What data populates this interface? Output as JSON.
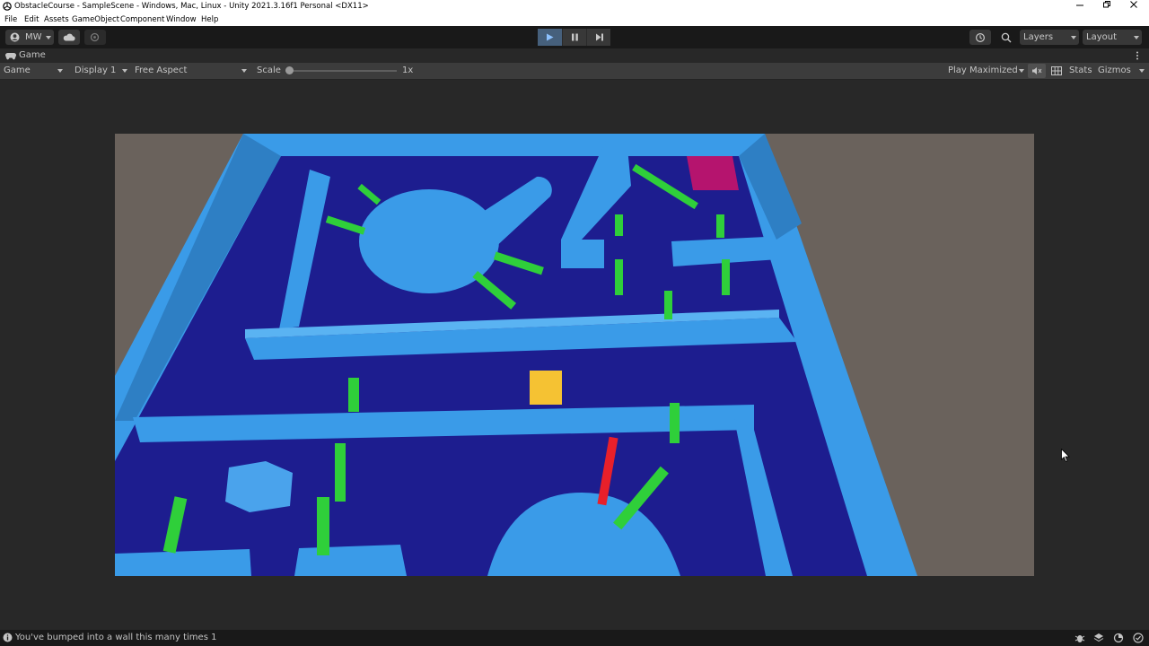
{
  "window": {
    "title": "ObstacleCourse - SampleScene - Windows, Mac, Linux - Unity 2021.3.16f1 Personal <DX11>"
  },
  "menu": [
    "File",
    "Edit",
    "Assets",
    "GameObject",
    "Component",
    "Window",
    "Help"
  ],
  "toolbar": {
    "account_label": "MW",
    "layers_label": "Layers",
    "layout_label": "Layout"
  },
  "tab": {
    "label": "Game"
  },
  "game_toolbar": {
    "mode": "Game",
    "display": "Display 1",
    "aspect": "Free Aspect",
    "scale_label": "Scale",
    "scale_value": "1x",
    "scale_fraction": 0.0,
    "play_mode": "Play Maximized",
    "stats_label": "Stats",
    "gizmos_label": "Gizmos"
  },
  "status": {
    "message": "You've bumped into a wall this many times 1"
  },
  "colors": {
    "floor": "#1d1d8f",
    "wall": "#3a9be8",
    "obstacle_green": "#2fcf3a",
    "player_yellow": "#f5c233",
    "goal_magenta": "#b5146e",
    "obstacle_red": "#e8202a",
    "background_ground": "#6a625c",
    "play_active": "#46607c"
  }
}
